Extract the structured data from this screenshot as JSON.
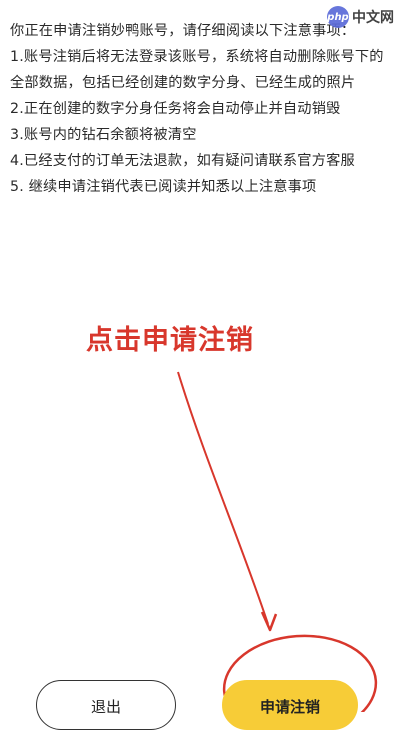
{
  "notice": {
    "lines": [
      "你正在申请注销妙鸭账号，请仔细阅读以下注意事项：",
      "1.账号注销后将无法登录该账号，系统将自动删除账号下的全部数据，包括已经创建的数字分身、已经生成的照片",
      "2.正在创建的数字分身任务将会自动停止并自动销毁",
      "3.账号内的钻石余额将被清空",
      "4.已经支付的订单无法退款，如有疑问请联系官方客服",
      "5. 继续申请注销代表已阅读并知悉以上注意事项"
    ]
  },
  "annotation": {
    "label": "点击申请注销",
    "color": "#d8372c"
  },
  "buttons": {
    "exit_label": "退出",
    "apply_label": "申请注销",
    "apply_color": "#f7cc37"
  },
  "watermark": {
    "badge": "php",
    "text": "中文网"
  }
}
